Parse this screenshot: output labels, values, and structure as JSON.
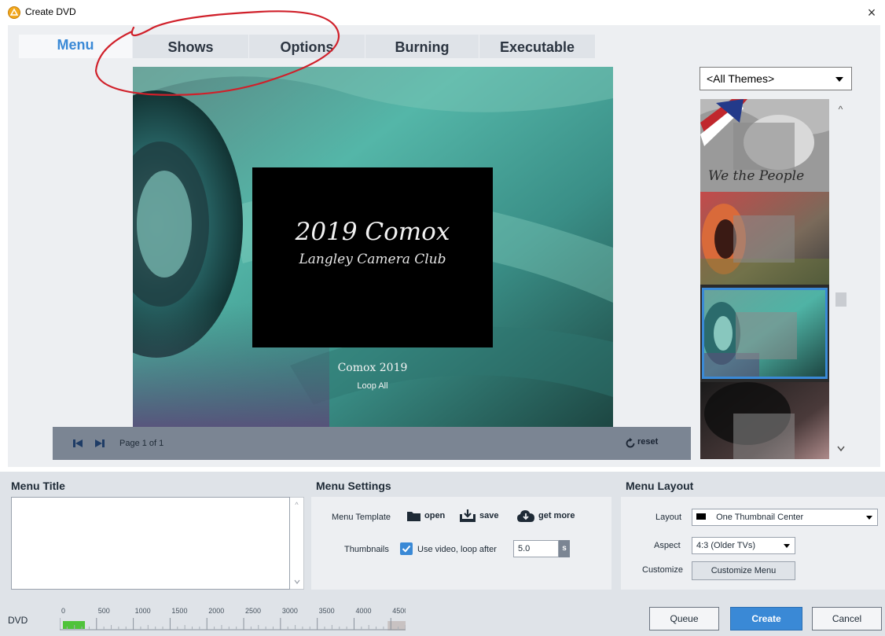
{
  "window": {
    "title": "Create DVD",
    "close_glyph": "×"
  },
  "tabs": [
    {
      "label": "Menu",
      "active": true
    },
    {
      "label": "Shows",
      "active": false
    },
    {
      "label": "Options",
      "active": false
    },
    {
      "label": "Burning",
      "active": false
    },
    {
      "label": "Executable",
      "active": false
    }
  ],
  "preview": {
    "headline": "2019 Comox",
    "subheadline": "Langley Camera Club",
    "show_title": "Comox 2019",
    "loop_label": "Loop All",
    "page_label": "Page 1 of 1",
    "reset_label": "reset"
  },
  "themes": {
    "selected_filter": "<All Themes>",
    "items": [
      {
        "icon": "flag-theme-thumbnail",
        "selected": false
      },
      {
        "icon": "red-lens-theme-thumbnail",
        "selected": false
      },
      {
        "icon": "teal-lens-theme-thumbnail",
        "selected": true
      },
      {
        "icon": "dark-lens-theme-thumbnail",
        "selected": false
      }
    ],
    "thumbnail_text": "We the People"
  },
  "menu_title": {
    "heading": "Menu Title",
    "value": ""
  },
  "menu_settings": {
    "heading": "Menu Settings",
    "template_label": "Menu Template",
    "open_label": "open",
    "save_label": "save",
    "get_more_label": "get more",
    "thumbnails_label": "Thumbnails",
    "use_video_label": "Use video, loop after",
    "use_video_checked": true,
    "loop_value": "5.0",
    "loop_unit": "s"
  },
  "menu_layout": {
    "heading": "Menu Layout",
    "layout_label": "Layout",
    "layout_value": "One Thumbnail Center",
    "aspect_label": "Aspect",
    "aspect_value": "4:3 (Older TVs)",
    "customize_label": "Customize",
    "customize_button": "Customize Menu"
  },
  "status": {
    "disc_label": "DVD",
    "capacity_ticks": [
      "0",
      "500",
      "1000",
      "1500",
      "2000",
      "2500",
      "3000",
      "3500",
      "4000",
      "4500"
    ],
    "capacity_used_mb": 150,
    "capacity_limit_mb": 4500
  },
  "actions": {
    "queue": "Queue",
    "create": "Create",
    "cancel": "Cancel"
  },
  "colors": {
    "accent": "#3a89d6",
    "panel": "#edeff2",
    "bar": "#7b8593",
    "annotation": "#d0202a",
    "capacity_fill": "#4fc33a"
  }
}
